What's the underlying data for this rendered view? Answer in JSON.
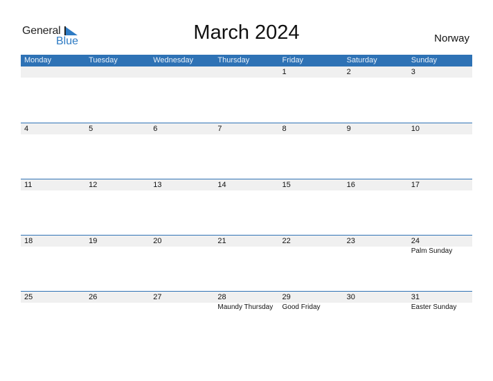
{
  "logo": {
    "word1": "General",
    "word2": "Blue",
    "icon": "triangle-flag-icon"
  },
  "title": "March 2024",
  "country": "Norway",
  "colors": {
    "accent": "#2e72b5",
    "day_row_bg": "#f0f0f0",
    "logo_blue": "#2e7bc4"
  },
  "weekdays": [
    "Monday",
    "Tuesday",
    "Wednesday",
    "Thursday",
    "Friday",
    "Saturday",
    "Sunday"
  ],
  "weeks": [
    {
      "days": [
        "",
        "",
        "",
        "",
        "1",
        "2",
        "3"
      ],
      "events": [
        "",
        "",
        "",
        "",
        "",
        "",
        ""
      ]
    },
    {
      "days": [
        "4",
        "5",
        "6",
        "7",
        "8",
        "9",
        "10"
      ],
      "events": [
        "",
        "",
        "",
        "",
        "",
        "",
        ""
      ]
    },
    {
      "days": [
        "11",
        "12",
        "13",
        "14",
        "15",
        "16",
        "17"
      ],
      "events": [
        "",
        "",
        "",
        "",
        "",
        "",
        ""
      ]
    },
    {
      "days": [
        "18",
        "19",
        "20",
        "21",
        "22",
        "23",
        "24"
      ],
      "events": [
        "",
        "",
        "",
        "",
        "",
        "",
        "Palm Sunday"
      ]
    },
    {
      "days": [
        "25",
        "26",
        "27",
        "28",
        "29",
        "30",
        "31"
      ],
      "events": [
        "",
        "",
        "",
        "Maundy Thursday",
        "Good Friday",
        "",
        "Easter Sunday"
      ]
    }
  ]
}
